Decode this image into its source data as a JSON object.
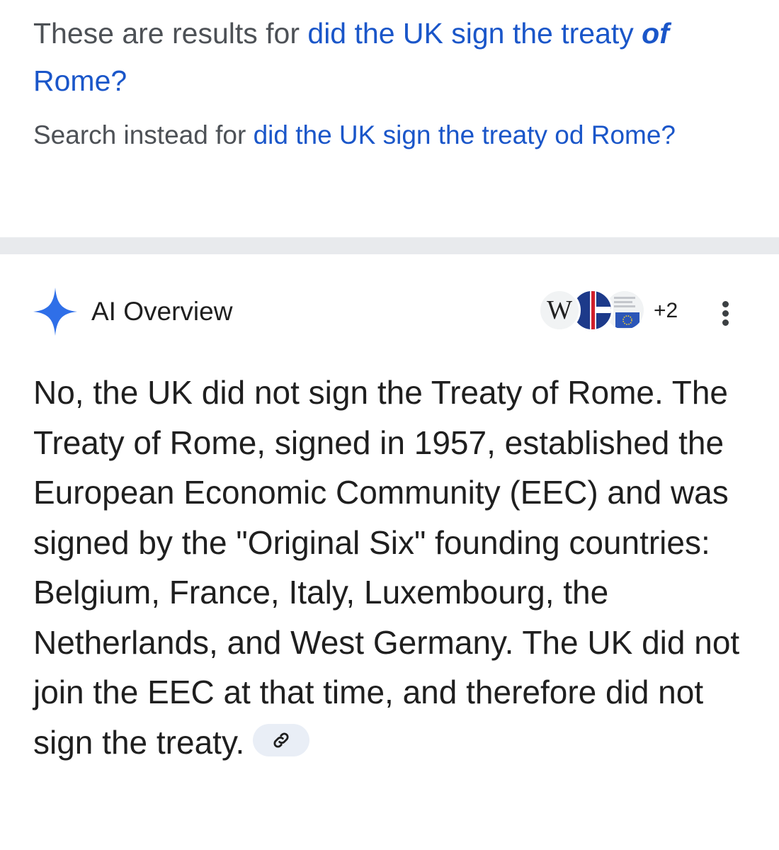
{
  "spelling": {
    "showing_prefix": "These are results for ",
    "corrected_part1": "did the UK sign the treaty ",
    "corrected_emphasis": "of",
    "corrected_part2": " Rome?",
    "instead_prefix": "Search instead for ",
    "instead_query": "did the UK sign the treaty od Rome?"
  },
  "ai_overview": {
    "title": "AI Overview",
    "more_sources": "+2",
    "source_icons": [
      "wikipedia-icon",
      "flag-icon",
      "eu-flag-icon"
    ],
    "answer": "No, the UK did not sign the Treaty of Rome. The Treaty of Rome, signed in 1957, established the European Economic Community (EEC) and was signed by the \"Original Six\" founding countries: Belgium, France, Italy, Luxembourg, the Netherlands, and West Germany. The UK did not join the EEC at that time, and therefore did not sign the treaty."
  },
  "colors": {
    "link": "#1a56c9",
    "muted_text": "#4d5156",
    "divider": "#e8eaed",
    "sparkle": "#2f6fe8",
    "chip": "#e9eef6"
  }
}
